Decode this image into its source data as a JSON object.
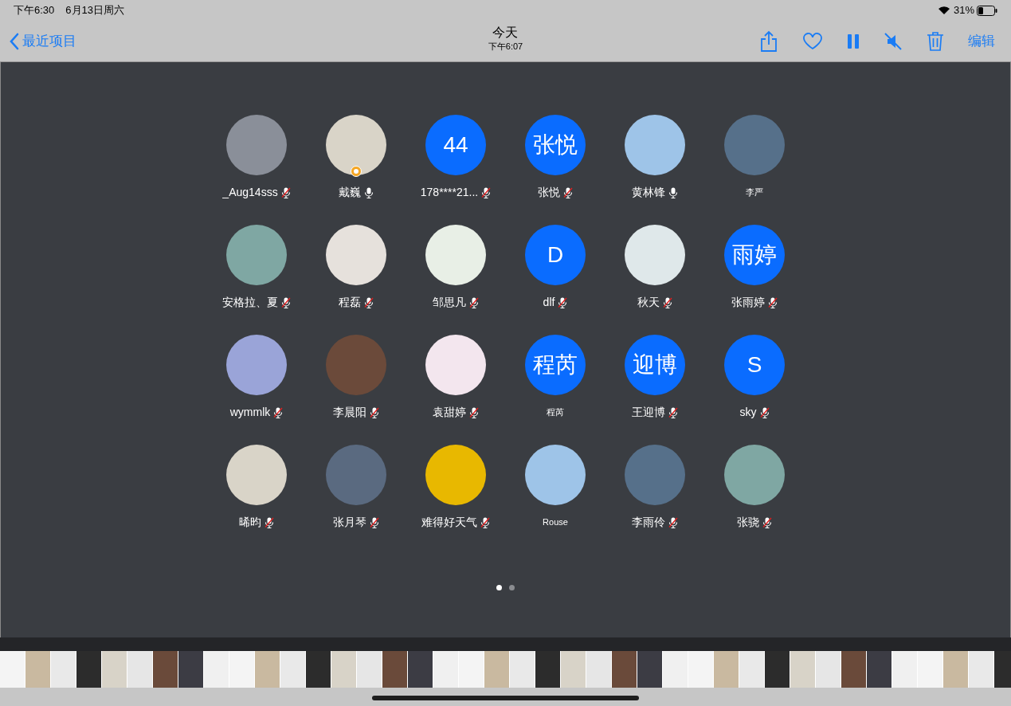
{
  "status_bar": {
    "time": "下午6:30",
    "date": "6月13日周六",
    "battery": "31%"
  },
  "nav": {
    "back": "最近项目",
    "title": "今天",
    "subtitle": "下午6:07",
    "edit": "编辑"
  },
  "participants": [
    {
      "name": "_Aug14sss",
      "kind": "photo",
      "muted": true,
      "host": false
    },
    {
      "name": "戴巍",
      "kind": "photo",
      "muted": false,
      "host": true
    },
    {
      "name": "178****21...",
      "kind": "initials",
      "initials": "44",
      "muted": true,
      "host": false
    },
    {
      "name": "张悦",
      "kind": "initials",
      "initials": "张悦",
      "muted": true,
      "host": false
    },
    {
      "name": "黄林锋",
      "kind": "photo",
      "muted": false,
      "host": false
    },
    {
      "name": "李严",
      "kind": "photo",
      "host": false
    },
    {
      "name": "安格拉、夏",
      "kind": "photo",
      "muted": true,
      "host": false
    },
    {
      "name": "程磊",
      "kind": "photo",
      "muted": true,
      "host": false
    },
    {
      "name": "邹思凡",
      "kind": "photo",
      "muted": true,
      "host": false
    },
    {
      "name": "dlf",
      "kind": "initials",
      "initials": "D",
      "muted": true,
      "host": false
    },
    {
      "name": "秋天",
      "kind": "photo",
      "muted": true,
      "host": false
    },
    {
      "name": "张雨婷",
      "kind": "initials",
      "initials": "雨婷",
      "muted": true,
      "host": false
    },
    {
      "name": "wymmlk",
      "kind": "photo",
      "muted": true,
      "host": false
    },
    {
      "name": "李晨阳",
      "kind": "photo",
      "muted": true,
      "host": false
    },
    {
      "name": "袁甜婷",
      "kind": "photo",
      "muted": true,
      "host": false
    },
    {
      "name": "程芮",
      "kind": "initials",
      "initials": "程芮",
      "host": false
    },
    {
      "name": "王迎博",
      "kind": "initials",
      "initials": "迎博",
      "muted": true,
      "host": false
    },
    {
      "name": "sky",
      "kind": "initials",
      "initials": "S",
      "muted": true,
      "host": false
    },
    {
      "name": "晞昀",
      "kind": "photo",
      "muted": true,
      "host": false
    },
    {
      "name": "张月琴",
      "kind": "photo",
      "muted": true,
      "host": false
    },
    {
      "name": "难得好天气",
      "kind": "photo",
      "muted": true,
      "host": false
    },
    {
      "name": "Rouse",
      "kind": "photo",
      "host": false
    },
    {
      "name": "李雨伶",
      "kind": "photo",
      "muted": true,
      "host": false
    },
    {
      "name": "张骁",
      "kind": "photo",
      "muted": true,
      "host": false
    }
  ],
  "pages": [
    {
      "selected": true
    },
    {
      "selected": false
    }
  ]
}
